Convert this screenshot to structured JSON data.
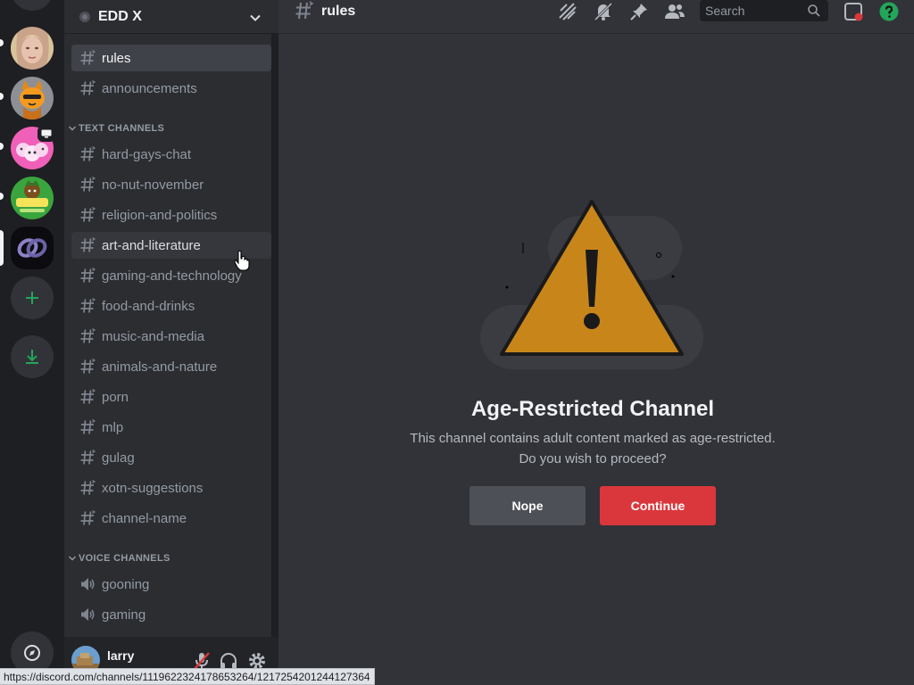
{
  "server": {
    "name": "EDD X"
  },
  "channel": {
    "title": "rules"
  },
  "search": {
    "placeholder": "Search"
  },
  "channels_top": [
    {
      "name": "rules",
      "selected": true
    },
    {
      "name": "announcements"
    }
  ],
  "categories": {
    "text": "TEXT CHANNELS",
    "voice": "VOICE CHANNELS"
  },
  "text_channels": [
    "hard-gays-chat",
    "no-nut-november",
    "religion-and-politics",
    "art-and-literature",
    "gaming-and-technology",
    "food-and-drinks",
    "music-and-media",
    "animals-and-nature",
    "porn",
    "mlp",
    "gulag",
    "xotn-suggestions",
    "channel-name"
  ],
  "hovered_channel": "art-and-literature",
  "voice_channels": [
    "gooning",
    "gaming"
  ],
  "user": {
    "name": "larry"
  },
  "gate": {
    "title": "Age-Restricted Channel",
    "desc_line1": "This channel contains adult content marked as age-restricted.",
    "desc_line2": "Do you wish to proceed?",
    "nope_label": "Nope",
    "continue_label": "Continue"
  },
  "status_url": "https://discord.com/channels/1119622324178653264/1217254201244127364",
  "colors": {
    "danger": "#da373c",
    "warning": "#c8861a",
    "green": "#23a55a",
    "selected": "#404249"
  }
}
